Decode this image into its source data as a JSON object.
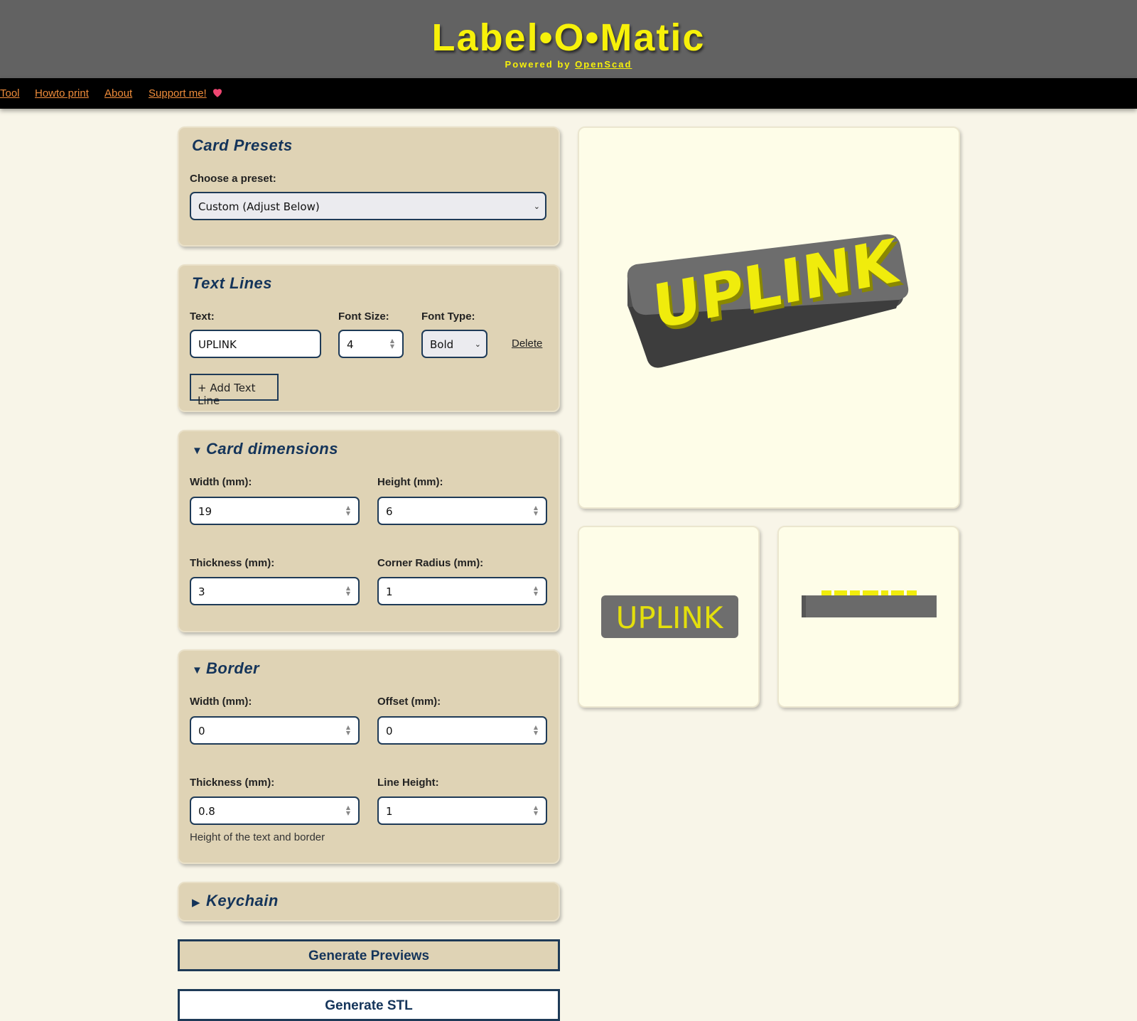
{
  "header": {
    "title": "Label•O•Matic",
    "powered_prefix": "Powered by",
    "powered_link": "OpenScad",
    "title_color": "#f7f10a",
    "bg_color": "#626262"
  },
  "nav": {
    "items": [
      {
        "label": "Tool"
      },
      {
        "label": "Howto print"
      },
      {
        "label": "About"
      },
      {
        "label": "Support me!"
      }
    ],
    "link_color": "#ef8c3a"
  },
  "presets": {
    "title": "Card Presets",
    "choose_label": "Choose a preset:",
    "selected": "Custom (Adjust Below)"
  },
  "text_lines": {
    "title": "Text Lines",
    "text_label": "Text:",
    "font_size_label": "Font Size:",
    "font_type_label": "Font Type:",
    "rows": [
      {
        "text": "UPLINK",
        "font_size": "4",
        "font_type": "Bold",
        "delete_label": "Delete"
      }
    ],
    "add_label": "+ Add Text Line"
  },
  "card_dimensions": {
    "title": "Card dimensions",
    "expanded": true,
    "width_label": "Width (mm):",
    "width": "19",
    "height_label": "Height (mm):",
    "height": "6",
    "thickness_label": "Thickness (mm):",
    "thickness": "3",
    "radius_label": "Corner Radius (mm):",
    "radius": "1"
  },
  "border": {
    "title": "Border",
    "expanded": true,
    "width_label": "Width (mm):",
    "width": "0",
    "offset_label": "Offset (mm):",
    "offset": "0",
    "thickness_label": "Thickness (mm):",
    "thickness": "0.8",
    "line_height_label": "Line Height:",
    "line_height": "1",
    "hint": "Height of the text and border"
  },
  "keychain": {
    "title": "Keychain",
    "expanded": false
  },
  "actions": {
    "generate_previews": "Generate Previews",
    "generate_stl": "Generate STL"
  },
  "previews": {
    "label_text": "UPLINK",
    "text_color": "#f0ec0c",
    "body_color": "#6e6e6e"
  }
}
